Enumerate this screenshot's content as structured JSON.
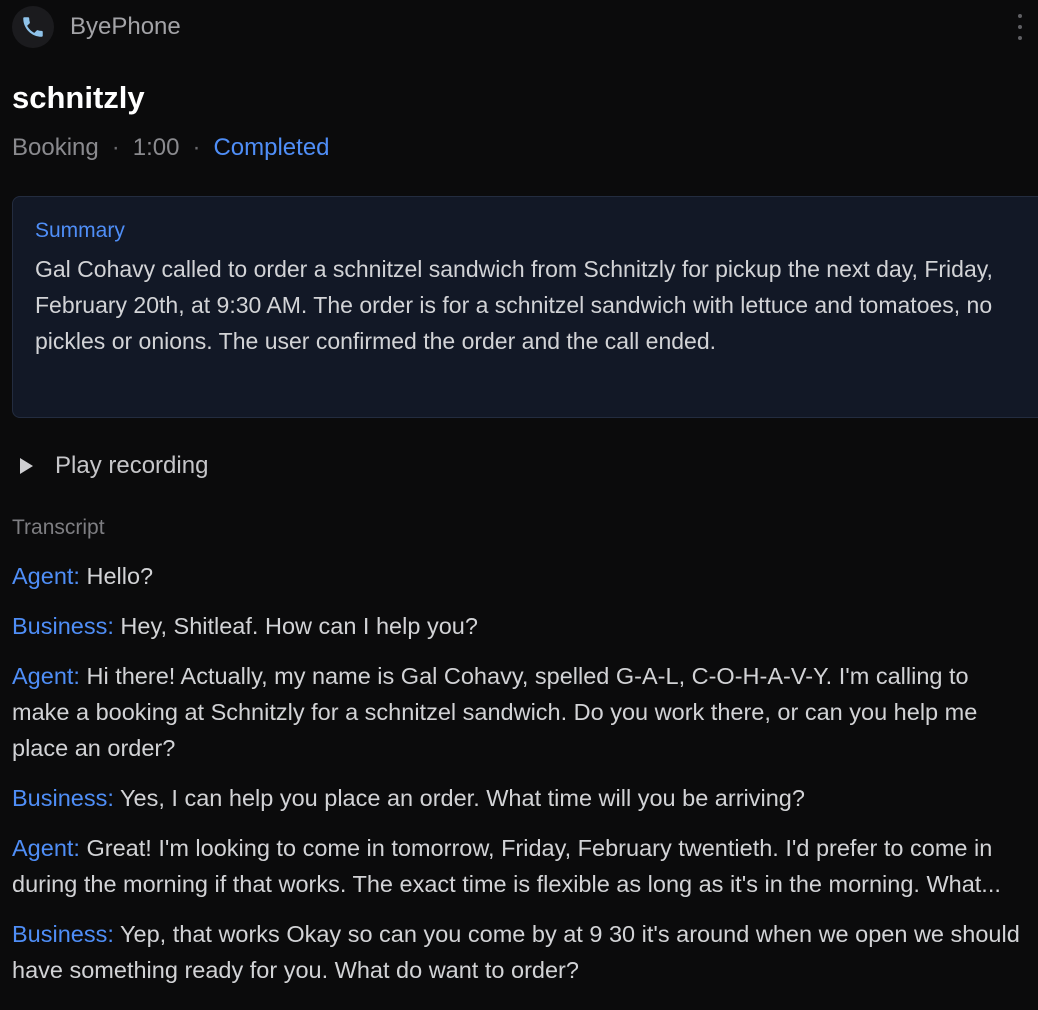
{
  "app": {
    "title": "ByePhone",
    "icon": "phone-icon"
  },
  "call": {
    "title": "schnitzly",
    "type": "Booking",
    "separator": "·",
    "duration": "1:00",
    "status": "Completed"
  },
  "summary": {
    "label": "Summary",
    "text": "Gal Cohavy called to order a schnitzel sandwich from Schnitzly for pickup the next day, Friday, February 20th, at 9:30 AM. The order is for a schnitzel sandwich with lettuce and tomatoes, no pickles or onions. The user confirmed the order and the call ended."
  },
  "recording": {
    "label": "Play recording",
    "icon": "play-icon"
  },
  "transcript": {
    "label": "Transcript",
    "turns": [
      {
        "speaker": "Agent:",
        "text": "Hello?"
      },
      {
        "speaker": "Business:",
        "text": "Hey, Shitleaf. How can I help you?"
      },
      {
        "speaker": "Agent:",
        "text": "Hi there! Actually, my name is Gal Cohavy, spelled G-A-L, C-O-H-A-V-Y. I'm calling to make a booking at Schnitzly for a schnitzel sandwich. Do you work there, or can you help me place an order?"
      },
      {
        "speaker": "Business:",
        "text": "Yes, I can help you place an order. What time will you be arriving?"
      },
      {
        "speaker": "Agent:",
        "text": "Great! I'm looking to come in tomorrow, Friday, February twentieth. I'd prefer to come in during the morning if that works. The exact time is flexible as long as it's in the morning. What..."
      },
      {
        "speaker": "Business:",
        "text": "Yep, that works Okay so can you come by at 9 30 it's around when we open we should have something ready for you. What do want to order?"
      }
    ]
  },
  "colors": {
    "background": "#0b0b0c",
    "accent": "#4f8ef7",
    "summary_bg": "#121826"
  }
}
